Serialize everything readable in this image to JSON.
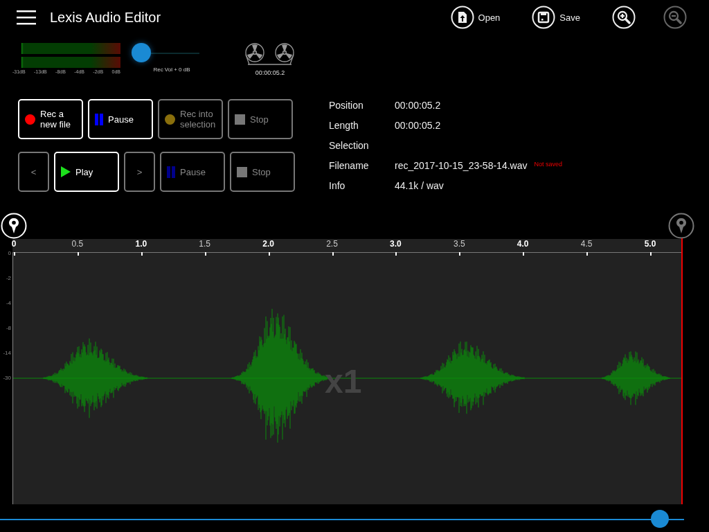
{
  "app_bar": {
    "title": "Lexis Audio Editor",
    "actions": [
      {
        "kind": "open",
        "label": "Open",
        "disabled": false
      },
      {
        "kind": "save",
        "label": "Save",
        "disabled": false
      },
      {
        "kind": "zoom_in",
        "disabled": false
      },
      {
        "kind": "zoom_out",
        "disabled": true
      }
    ]
  },
  "level_meter": {
    "scale": [
      "-31dB",
      "-13dB",
      "-8dB",
      "-4dB",
      "-2dB",
      "0dB"
    ]
  },
  "rec_volume": {
    "level": 0.13,
    "reading": "Rec Vol + 0 dB"
  },
  "tape": {
    "time": "00:00:05.2"
  },
  "record_buttons": [
    {
      "kind": "rec",
      "label": "Rec a new file",
      "disabled": false
    },
    {
      "kind": "pause",
      "label": "Pause",
      "disabled": false
    },
    {
      "kind": "rec_selection",
      "label": "Rec into selection",
      "disabled": true
    },
    {
      "kind": "stop",
      "label": "Stop",
      "disabled": true
    }
  ],
  "play_buttons": [
    {
      "kind": "prev",
      "label": "<",
      "disabled": true
    },
    {
      "kind": "play",
      "label": "Play",
      "disabled": false
    },
    {
      "kind": "next",
      "label": ">",
      "disabled": true
    },
    {
      "kind": "pause",
      "label": "Pause",
      "disabled": true
    },
    {
      "kind": "stop",
      "label": "Stop",
      "disabled": true
    }
  ],
  "info": [
    {
      "label": "Position",
      "value": "00:00:05.2"
    },
    {
      "label": "Length",
      "value": "00:00:05.2"
    },
    {
      "label": "Selection"
    },
    {
      "label": "Filename",
      "value": "rec_2017-10-15_23-58-14.wav",
      "note": "Not saved"
    },
    {
      "label": "Info",
      "value": "44.1k / wav"
    }
  ],
  "markers": [
    {
      "disabled": false
    },
    {
      "disabled": true
    }
  ],
  "timeline": {
    "ticks": [
      {
        "label": "0",
        "major": true
      },
      {
        "label": "0.5",
        "major": false
      },
      {
        "label": "1.0",
        "major": true
      },
      {
        "label": "1.5",
        "major": false
      },
      {
        "label": "2.0",
        "major": true
      },
      {
        "label": "2.5",
        "major": false
      },
      {
        "label": "3.0",
        "major": true
      },
      {
        "label": "3.5",
        "major": false
      },
      {
        "label": "4.0",
        "major": true
      },
      {
        "label": "4.5",
        "major": false
      },
      {
        "label": "5.0",
        "major": true
      }
    ]
  },
  "waveform": {
    "y_axis": [
      "0",
      "-2",
      "-4",
      "-8",
      "-14",
      "-30"
    ],
    "zoom": "x1"
  },
  "scroll": {
    "level": 0.965
  }
}
